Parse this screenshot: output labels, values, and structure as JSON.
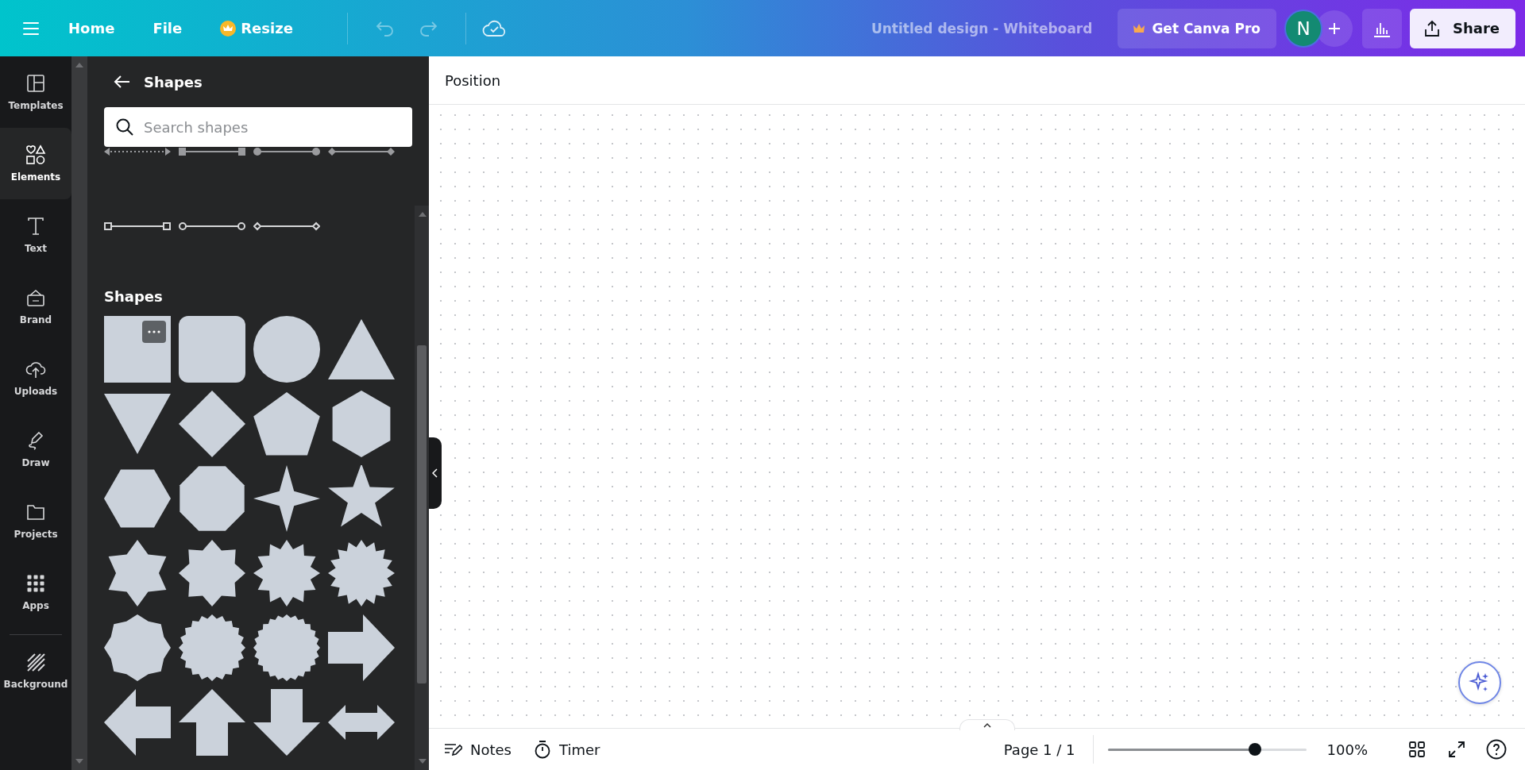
{
  "top_bar": {
    "nav": [
      {
        "kind": "link",
        "label": "Home"
      },
      {
        "kind": "link",
        "label": "File"
      },
      {
        "kind": "pro",
        "label": "Resize"
      }
    ],
    "history": [
      {
        "kind": "undo",
        "disabled": true
      },
      {
        "kind": "redo",
        "disabled": true
      }
    ],
    "design_title": "Untitled design - Whiteboard",
    "pro_button": "Get Canva Pro",
    "avatar": "N",
    "share_button": "Share"
  },
  "rail": {
    "items": [
      {
        "kind": "templates",
        "label": "Templates",
        "selected": false
      },
      {
        "kind": "elements",
        "label": "Elements",
        "selected": true
      },
      {
        "kind": "text",
        "label": "Text",
        "selected": false
      },
      {
        "kind": "brand",
        "label": "Brand",
        "selected": false
      },
      {
        "kind": "uploads",
        "label": "Uploads",
        "selected": false
      },
      {
        "kind": "draw",
        "label": "Draw",
        "selected": false
      },
      {
        "kind": "projects",
        "label": "Projects",
        "selected": false
      },
      {
        "kind": "apps",
        "label": "Apps",
        "selected": false
      },
      {
        "kind": "background",
        "label": "Background",
        "selected": false
      }
    ]
  },
  "panel": {
    "title": "Shapes",
    "search": {
      "placeholder": "Search shapes"
    },
    "section_heading": "Shapes"
  },
  "canvas": {
    "toolbar_label": "Position"
  },
  "bottom_bar": {
    "notes": "Notes",
    "timer": "Timer",
    "page": "Page 1 / 1",
    "zoom": {
      "level": 0.74
    },
    "zoom_reading": "100%"
  }
}
